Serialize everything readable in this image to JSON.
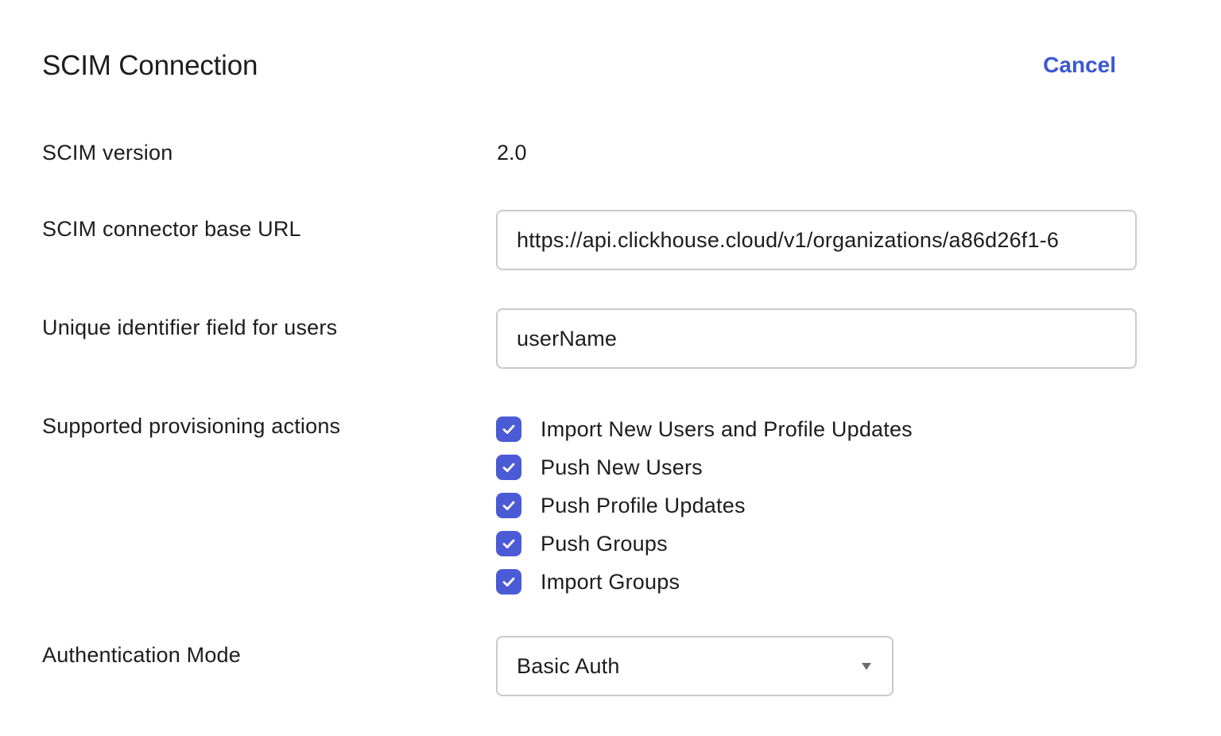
{
  "header": {
    "title": "SCIM Connection",
    "cancel_label": "Cancel"
  },
  "scim_version": {
    "label": "SCIM version",
    "value": "2.0"
  },
  "base_url": {
    "label": "SCIM connector base URL",
    "value": "https://api.clickhouse.cloud/v1/organizations/a86d26f1-6"
  },
  "unique_identifier": {
    "label": "Unique identifier field for users",
    "value": "userName"
  },
  "provisioning": {
    "label": "Supported provisioning actions",
    "actions": [
      {
        "label": "Import New Users and Profile Updates",
        "checked": true
      },
      {
        "label": "Push New Users",
        "checked": true
      },
      {
        "label": "Push Profile Updates",
        "checked": true
      },
      {
        "label": "Push Groups",
        "checked": true
      },
      {
        "label": "Import Groups",
        "checked": true
      }
    ]
  },
  "auth_mode": {
    "label": "Authentication Mode",
    "selected": "Basic Auth"
  },
  "colors": {
    "accent": "#3a57d4",
    "checkbox": "#4b5bd6",
    "border": "#c9c9cf",
    "text": "#1d1d21"
  },
  "icons": {
    "checkbox": "checkmark-icon",
    "dropdown": "caret-down-icon"
  }
}
